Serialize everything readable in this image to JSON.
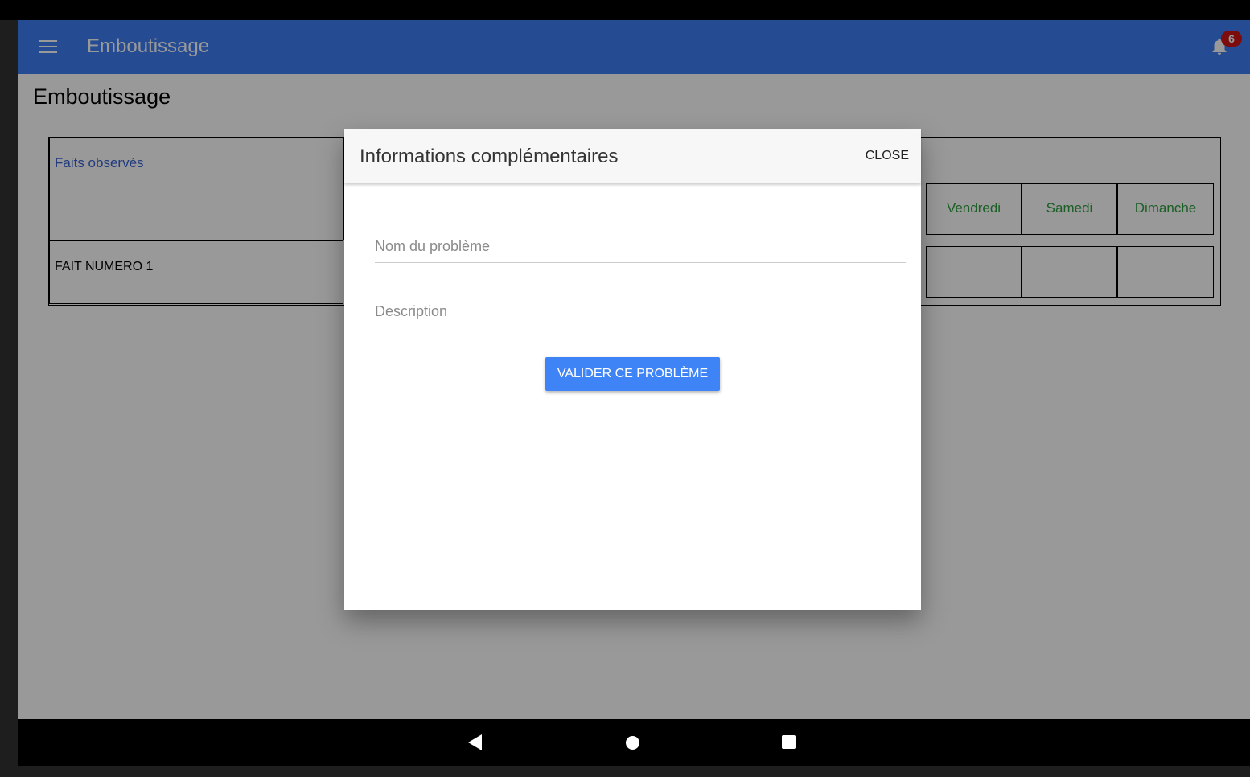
{
  "app_bar": {
    "title": "Emboutissage",
    "menu_icon": "hamburger-menu-icon",
    "notification_icon": "bell-icon",
    "notification_count": "6",
    "color": "#3f7ef5"
  },
  "page": {
    "title": "Emboutissage"
  },
  "table": {
    "facts_header": "Faits observés",
    "day_headers": [
      "Vendredi",
      "Samedi",
      "Dimanche"
    ],
    "rows": [
      {
        "label": "FAIT NUMERO 1"
      }
    ],
    "header_color": "#3a63d0",
    "day_color": "#2e9e3e"
  },
  "dialog": {
    "title": "Informations complémentaires",
    "close_label": "CLOSE",
    "problem_name_placeholder": "Nom du problème",
    "description_placeholder": "Description",
    "submit_label": "VALIDER CE PROBLÈME",
    "submit_color": "#3f84f7"
  },
  "system_nav": {
    "back_icon": "back-triangle-icon",
    "home_icon": "home-circle-icon",
    "recent_icon": "recent-apps-square-icon"
  }
}
